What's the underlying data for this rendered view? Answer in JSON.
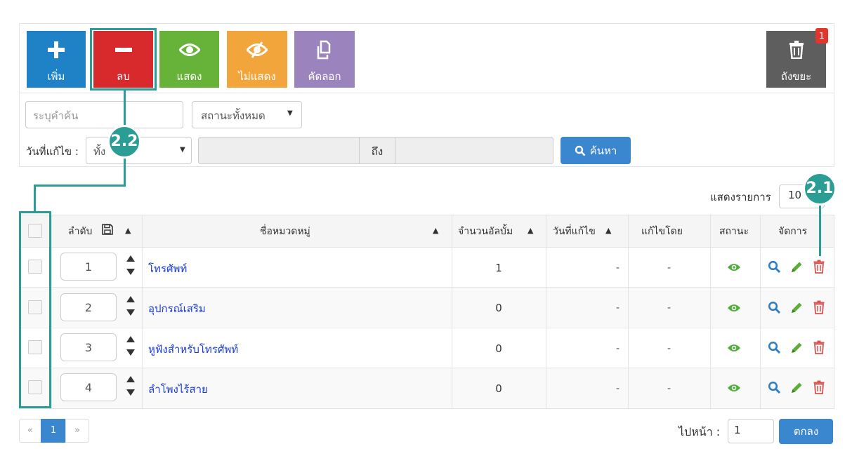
{
  "toolbar": {
    "add_label": "เพิ่ม",
    "delete_label": "ลบ",
    "show_label": "แสดง",
    "hide_label": "ไม่แสดง",
    "copy_label": "คัดลอก",
    "trash_label": "ถังขยะ",
    "trash_badge": "1"
  },
  "filters": {
    "search_placeholder": "ระบุคำค้น",
    "status_value": "สถานะทั้งหมด",
    "date_label": "วันที่แก้ไข :",
    "date_value": "ทั้ง",
    "range_to": "ถึง",
    "search_button": "ค้นหา"
  },
  "per_page": {
    "label": "แสดงรายการ",
    "value": "10"
  },
  "table": {
    "headers": {
      "order": "ลำดับ",
      "name": "ชื่อหมวดหมู่",
      "count": "จำนวนอัลบั้ม",
      "date": "วันที่แก้ไข",
      "editor": "แก้ไขโดย",
      "status": "สถานะ",
      "actions": "จัดการ"
    },
    "rows": [
      {
        "order": "1",
        "name": "โทรศัพท์",
        "count": "1",
        "date": "-",
        "editor": "-"
      },
      {
        "order": "2",
        "name": "อุปกรณ์เสริม",
        "count": "0",
        "date": "-",
        "editor": "-"
      },
      {
        "order": "3",
        "name": "หูฟังสำหรับโทรศัพท์",
        "count": "0",
        "date": "-",
        "editor": "-"
      },
      {
        "order": "4",
        "name": "ลำโพงไร้สาย",
        "count": "0",
        "date": "-",
        "editor": "-"
      }
    ]
  },
  "pagination": {
    "prev": "«",
    "current": "1",
    "next": "»"
  },
  "goto": {
    "label": "ไปหน้า :",
    "value": "1",
    "button": "ตกลง"
  },
  "annotations": {
    "marker_a": "2.1",
    "marker_b": "2.2"
  },
  "colors": {
    "accent": "#2a9d94",
    "primary": "#3a86cf",
    "danger": "#d8292d",
    "success": "#67b339",
    "warning": "#f2a53a",
    "purple": "#9b84bd",
    "link": "#1a3bdc"
  }
}
